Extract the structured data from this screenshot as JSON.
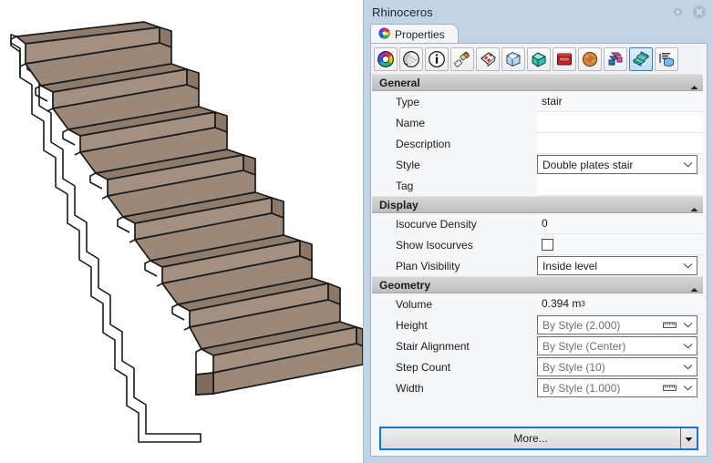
{
  "window": {
    "title": "Rhinoceros",
    "buttons": [
      {
        "name": "settings-gear-button",
        "icon": "gear-icon"
      },
      {
        "name": "close-button",
        "icon": "close-icon"
      }
    ]
  },
  "tabs": [
    {
      "label": "Properties",
      "icon": "color-wheel-icon",
      "active": true
    }
  ],
  "toolbar": {
    "buttons": [
      {
        "name": "object-properties-icon",
        "label": "Object properties",
        "selected": false
      },
      {
        "name": "render-mesh-icon",
        "label": "Render mesh",
        "selected": false
      },
      {
        "name": "details-info-icon",
        "label": "Details",
        "selected": false
      },
      {
        "name": "material-icon",
        "label": "Material",
        "selected": false
      },
      {
        "name": "texture-mapping-icon",
        "label": "Texture mapping",
        "selected": false
      },
      {
        "name": "display-mode-icon",
        "label": "Display mode",
        "selected": false
      },
      {
        "name": "object-icon",
        "label": "Object",
        "selected": false
      },
      {
        "name": "print-width-icon",
        "label": "Print width",
        "selected": false
      },
      {
        "name": "environment-icon",
        "label": "Environment",
        "selected": false
      },
      {
        "name": "linked-blocks-icon",
        "label": "Linked blocks",
        "selected": false
      },
      {
        "name": "stair-icon",
        "label": "Stair",
        "selected": true
      },
      {
        "name": "database-list-icon",
        "label": "Object list",
        "selected": false
      }
    ]
  },
  "sections": [
    {
      "id": "general",
      "title": "General",
      "expanded": true,
      "collapse_icon": "chevron-up-icon",
      "rows": [
        {
          "label": "Type",
          "kind": "text",
          "value": "stair",
          "name": "type"
        },
        {
          "label": "Name",
          "kind": "blank",
          "value": "",
          "name": "name"
        },
        {
          "label": "Description",
          "kind": "blank",
          "value": "",
          "name": "description"
        },
        {
          "label": "Style",
          "kind": "combo",
          "value": "Double plates stair",
          "bystyle": false,
          "ruler": false,
          "name": "style"
        },
        {
          "label": "Tag",
          "kind": "blank",
          "value": "",
          "name": "tag"
        }
      ]
    },
    {
      "id": "display",
      "title": "Display",
      "expanded": true,
      "collapse_icon": "chevron-up-icon",
      "rows": [
        {
          "label": "Isocurve Density",
          "kind": "text",
          "value": "0",
          "name": "isocurve-density"
        },
        {
          "label": "Show Isocurves",
          "kind": "checkbox",
          "value": "",
          "checked": false,
          "name": "show-isocurves"
        },
        {
          "label": "Plan Visibility",
          "kind": "combo",
          "value": "Inside level",
          "bystyle": false,
          "ruler": false,
          "name": "plan-visibility"
        }
      ]
    },
    {
      "id": "geometry",
      "title": "Geometry",
      "expanded": true,
      "collapse_icon": "chevron-up-icon",
      "rows": [
        {
          "label": "Volume",
          "kind": "volume",
          "value": "0.394 m",
          "superscript": "3",
          "name": "volume"
        },
        {
          "label": "Height",
          "kind": "combo",
          "value": "By Style (2.000)",
          "bystyle": true,
          "ruler": true,
          "name": "height"
        },
        {
          "label": "Stair Alignment",
          "kind": "combo",
          "value": "By Style (Center)",
          "bystyle": true,
          "ruler": false,
          "name": "stair-alignment"
        },
        {
          "label": "Step Count",
          "kind": "combo",
          "value": "By Style (10)",
          "bystyle": true,
          "ruler": false,
          "name": "step-count"
        },
        {
          "label": "Width",
          "kind": "combo",
          "value": "By Style (1.000)",
          "bystyle": true,
          "ruler": true,
          "name": "width"
        }
      ]
    }
  ],
  "footer": {
    "more_label": "More...",
    "dropdown_icon": "caret-down-icon"
  },
  "viewport": {
    "model_name": "stair-3d-model",
    "background_color": "#ffffff",
    "face_top_color": "#a08d7d",
    "face_front_color": "#9c8878",
    "face_side_color": "#8e7b6c",
    "edge_color": "#1a1a1a",
    "step_count_visible": 11
  },
  "colors": {
    "panel_chrome": "#c3d3e6",
    "panel_background": "#f4f6f8",
    "section_header": "#cacaca",
    "accent_focus": "#1275d4",
    "bystyle_text": "#6f6f6f"
  }
}
